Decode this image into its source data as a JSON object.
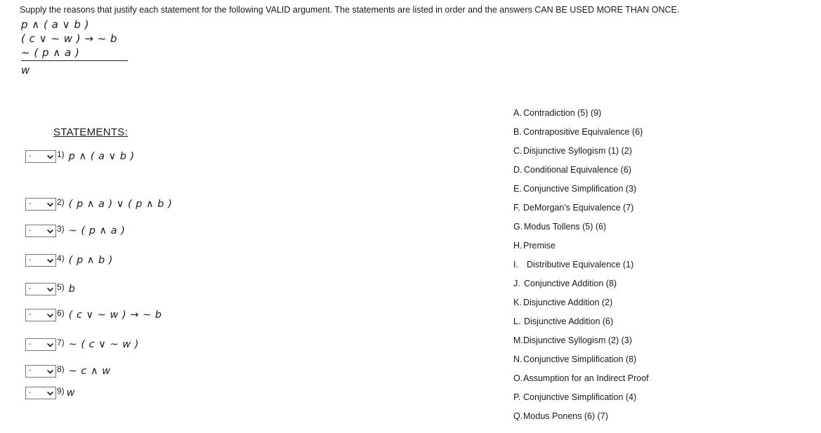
{
  "instruction": "Supply the reasons that justify each statement for the following VALID argument.  The statements are listed in order and the answers CAN BE USED MORE THAN ONCE.",
  "argument": {
    "premises": [
      "p ∧ ( a ∨ b )",
      "( c ∨ ~ w ) →  ~ b",
      "~ ( p ∧ a )"
    ],
    "conclusion": "w"
  },
  "statements_heading": "STATEMENTS:",
  "select": {
    "value": "-",
    "icon": "chevron-down-icon"
  },
  "statements": [
    {
      "number": "1)",
      "text": "p ∧ ( a ∨ b )"
    },
    {
      "number": "2)",
      "text": "( p ∧ a ) ∨ ( p ∧ b )"
    },
    {
      "number": "3)",
      "text": "~ ( p ∧ a )"
    },
    {
      "number": "4)",
      "text": "( p ∧ b )"
    },
    {
      "number": "5)",
      "text": "b"
    },
    {
      "number": "6)",
      "text": "( c ∨ ~ w ) →  ~ b"
    },
    {
      "number": "7)",
      "text": "~ ( c ∨ ~ w )"
    },
    {
      "number": "8)",
      "text": "~ c ∧ w"
    },
    {
      "number": "9)",
      "text": "w"
    }
  ],
  "options": [
    {
      "letter": "A.",
      "label": "Contradiction (5) (9)"
    },
    {
      "letter": "B.",
      "label": "Contrapositive Equivalence (6)"
    },
    {
      "letter": "C.",
      "label": "Disjunctive Syllogism (1) (2)"
    },
    {
      "letter": "D.",
      "label": "Conditional Equivalence (6)"
    },
    {
      "letter": "E.",
      "label": "Conjunctive Simplification (3)"
    },
    {
      "letter": "F.",
      "label": "DeMorgan's Equivalence  (7)"
    },
    {
      "letter": "G.",
      "label": "Modus Tollens (5) (6)"
    },
    {
      "letter": "H.",
      "label": "Premise"
    },
    {
      "letter": "I.",
      "label": "Distributive Equivalence (1)"
    },
    {
      "letter": "J.",
      "label": "Conjunctive Addition (8)"
    },
    {
      "letter": "K.",
      "label": "Disjunctive Addition (2)"
    },
    {
      "letter": "L.",
      "label": "Disjunctive Addition (6)"
    },
    {
      "letter": "M.",
      "label": "Disjunctive Syllogism (2) (3)"
    },
    {
      "letter": "N.",
      "label": "Conjunctive Simplification (8)"
    },
    {
      "letter": "O.",
      "label": "Assumption for an Indirect Proof"
    },
    {
      "letter": "P.",
      "label": "Conjunctive Simplification (4)"
    },
    {
      "letter": "Q.",
      "label": "Modus Ponens (6) (7)"
    }
  ],
  "layout": {
    "statement_row_tops": [
      212,
      280,
      318,
      360,
      401,
      438,
      480,
      518,
      549
    ],
    "option_text_indent": [
      14,
      14,
      14,
      15,
      14,
      14,
      15,
      14,
      19,
      15,
      14,
      15,
      14,
      14,
      14,
      14,
      14
    ]
  },
  "colors": {
    "text": "#1a1a1a",
    "background": "#ffffff",
    "select_border": "#767676"
  }
}
